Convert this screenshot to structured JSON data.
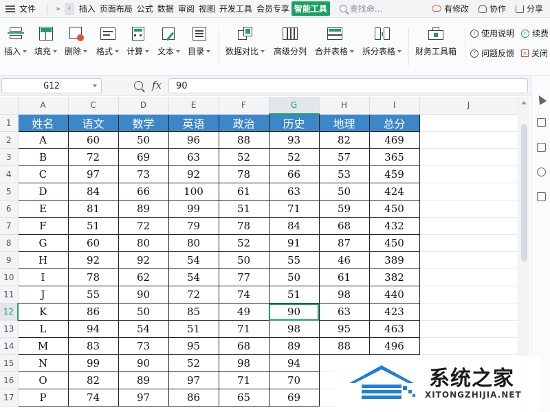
{
  "menubar": {
    "file_label": "文件",
    "more": "»",
    "back": "‹",
    "tabs": [
      "插入",
      "页面布局",
      "公式",
      "数据",
      "审阅",
      "视图",
      "开发工具",
      "会员专享",
      "智能工具"
    ],
    "active_tab_index": 8,
    "search_placeholder": "查找命...",
    "right": {
      "changes": "有修改",
      "collab": "协作",
      "share": "分享"
    }
  },
  "ribbon": {
    "buttons": {
      "insert": "插入",
      "fill": "填充",
      "delete": "删除",
      "format": "格式",
      "calc": "计算",
      "text": "文本",
      "toc": "目录",
      "compare": "数据对比",
      "split": "高级分列",
      "merge": "合并表格",
      "splittable": "拆分表格",
      "finance": "财务工具箱"
    },
    "help": {
      "usage": "使用说明",
      "continue": "续费",
      "feedback": "问题反馈",
      "close": "关闭"
    }
  },
  "formula_bar": {
    "cell_ref": "G12",
    "fx": "fx",
    "value": "90"
  },
  "grid": {
    "columns": [
      "A",
      "C",
      "D",
      "E",
      "F",
      "G",
      "H",
      "I",
      "J"
    ],
    "selected_column": "G",
    "selected_row": "12",
    "header": [
      "姓名",
      "语文",
      "数学",
      "英语",
      "政治",
      "历史",
      "地理",
      "总分"
    ],
    "rows": [
      {
        "n": "2",
        "cells": [
          "A",
          "60",
          "50",
          "96",
          "88",
          "93",
          "82",
          "469"
        ]
      },
      {
        "n": "3",
        "cells": [
          "B",
          "72",
          "69",
          "63",
          "52",
          "52",
          "57",
          "365"
        ]
      },
      {
        "n": "4",
        "cells": [
          "C",
          "97",
          "73",
          "92",
          "78",
          "66",
          "53",
          "459"
        ]
      },
      {
        "n": "5",
        "cells": [
          "D",
          "84",
          "66",
          "100",
          "61",
          "63",
          "50",
          "424"
        ]
      },
      {
        "n": "6",
        "cells": [
          "E",
          "81",
          "89",
          "99",
          "51",
          "71",
          "59",
          "450"
        ]
      },
      {
        "n": "7",
        "cells": [
          "F",
          "51",
          "72",
          "79",
          "78",
          "84",
          "68",
          "432"
        ]
      },
      {
        "n": "8",
        "cells": [
          "G",
          "60",
          "80",
          "80",
          "52",
          "91",
          "87",
          "450"
        ]
      },
      {
        "n": "9",
        "cells": [
          "H",
          "92",
          "92",
          "54",
          "50",
          "55",
          "46",
          "389"
        ]
      },
      {
        "n": "10",
        "cells": [
          "I",
          "78",
          "62",
          "54",
          "77",
          "50",
          "61",
          "382"
        ]
      },
      {
        "n": "11",
        "cells": [
          "J",
          "55",
          "90",
          "72",
          "74",
          "51",
          "98",
          "440"
        ]
      },
      {
        "n": "12",
        "cells": [
          "K",
          "86",
          "50",
          "85",
          "49",
          "90",
          "63",
          "423"
        ]
      },
      {
        "n": "13",
        "cells": [
          "L",
          "94",
          "54",
          "51",
          "71",
          "98",
          "95",
          "463"
        ]
      },
      {
        "n": "14",
        "cells": [
          "M",
          "83",
          "73",
          "95",
          "68",
          "89",
          "88",
          "496"
        ]
      },
      {
        "n": "15",
        "cells": [
          "N",
          "99",
          "90",
          "52",
          "98",
          "94",
          "",
          ""
        ]
      },
      {
        "n": "16",
        "cells": [
          "O",
          "82",
          "89",
          "97",
          "71",
          "70",
          "",
          ""
        ]
      },
      {
        "n": "17",
        "cells": [
          "P",
          "74",
          "97",
          "86",
          "65",
          "69",
          "",
          ""
        ]
      }
    ]
  },
  "watermark": {
    "title": "系统之家",
    "subtitle": "XITONGZHIJIA.NET"
  },
  "colors": {
    "accent": "#1aa260",
    "header_fill": "#3c87c9",
    "watermark_blue": "#1f7fd8"
  }
}
